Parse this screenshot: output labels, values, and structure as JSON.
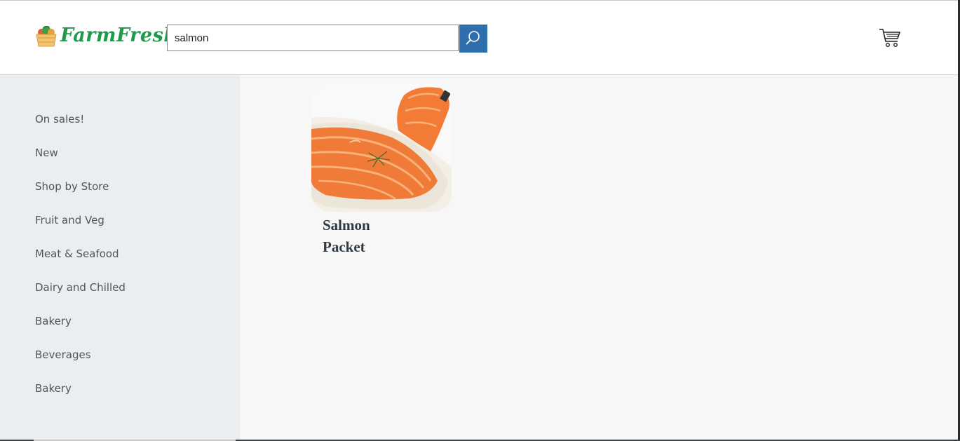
{
  "header": {
    "logo_text": "FarmFresh",
    "search": {
      "value": "salmon"
    }
  },
  "icons": {
    "logo": "basket-logo-icon",
    "search": "search-icon",
    "cart": "cart-icon"
  },
  "colors": {
    "brand_green": "#1f9a4a",
    "search_button": "#2f6fae",
    "sidebar_bg": "#eaeef0",
    "main_bg": "#f7f7f7",
    "product_title": "#2f3a45"
  },
  "sidebar": {
    "items": [
      {
        "label": "On sales!"
      },
      {
        "label": "New"
      },
      {
        "label": "Shop by Store"
      },
      {
        "label": "Fruit and Veg"
      },
      {
        "label": "Meat & Seafood"
      },
      {
        "label": "Dairy and Chilled"
      },
      {
        "label": "Bakery"
      },
      {
        "label": "Beverages"
      },
      {
        "label": "Bakery"
      }
    ]
  },
  "results": {
    "products": [
      {
        "name": "Salmon Packet",
        "image": "salmon-slices-image"
      }
    ]
  }
}
